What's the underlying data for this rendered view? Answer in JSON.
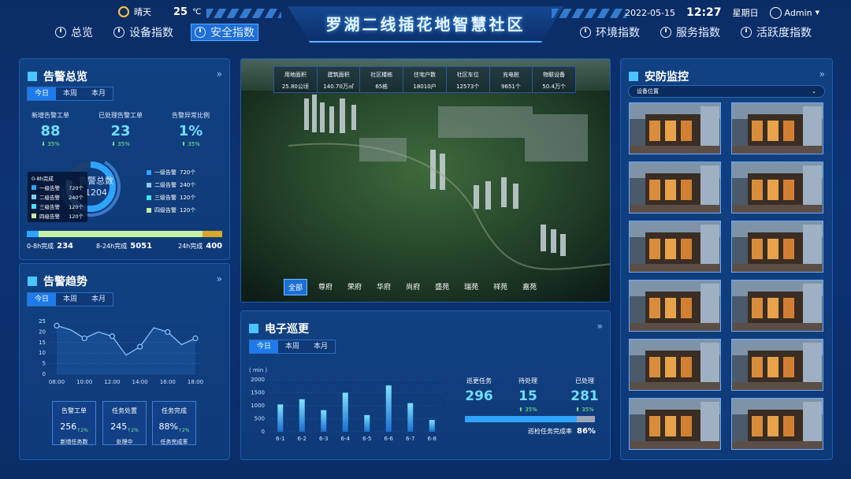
{
  "header": {
    "weather": "晴天",
    "temperature": "25",
    "unit": "℃",
    "date": "2022-05-15",
    "time": "12:27",
    "weekday": "星期日",
    "user": "Admin",
    "title": "罗湖二线插花地智慧社区",
    "nav_left": [
      "总览",
      "设备指数",
      "安全指数"
    ],
    "nav_right": [
      "环境指数",
      "服务指数",
      "活跃度指数"
    ],
    "active_nav": "安全指数"
  },
  "alarm_overview": {
    "title": "告警总览",
    "tabs": [
      "今日",
      "本周",
      "本月"
    ],
    "stats": [
      {
        "label": "新增告警工单",
        "value": "88",
        "change": "35%"
      },
      {
        "label": "已处理告警工单",
        "value": "23",
        "change": "35%"
      },
      {
        "label": "告警异常比例",
        "value": "1%",
        "change": "35%"
      }
    ],
    "donut_label": "告警总数",
    "donut_value": "1204",
    "legend": [
      {
        "name": "一级告警",
        "value": "720个",
        "color": "#2fa4ff"
      },
      {
        "name": "二级告警",
        "value": "240个",
        "color": "#7fd0ff"
      },
      {
        "name": "三级告警",
        "value": "120个",
        "color": "#41e3ff"
      },
      {
        "name": "四级告警",
        "value": "120个",
        "color": "#c3f0a2"
      }
    ],
    "tooltip": {
      "title": "0-8h完成",
      "items": [
        {
          "name": "一级告警",
          "value": "720个"
        },
        {
          "name": "二级告警",
          "value": "240个"
        },
        {
          "name": "三级告警",
          "value": "120个"
        },
        {
          "name": "四级告警",
          "value": "120个"
        }
      ]
    },
    "progress": [
      {
        "label": "0-8h完成",
        "value": "234",
        "color": "#2fa4ff"
      },
      {
        "label": "8-24h完成",
        "value": "5051",
        "color": "#c3f0a2"
      },
      {
        "label": "24h完成",
        "value": "400",
        "color": "#d9a82a"
      }
    ]
  },
  "alarm_trend": {
    "title": "告警趋势",
    "tabs": [
      "今日",
      "本周",
      "本月"
    ],
    "chart_data": {
      "type": "line",
      "x": [
        "08:00",
        "09:00",
        "10:00",
        "11:00",
        "12:00",
        "13:00",
        "14:00",
        "15:00",
        "16:00",
        "17:00",
        "18:00"
      ],
      "y": [
        23,
        21,
        17,
        20,
        18,
        9,
        13,
        22,
        20,
        14,
        17
      ],
      "yticks": [
        0,
        5,
        10,
        15,
        20,
        25
      ],
      "xticks": [
        "08:00",
        "10:00",
        "12:00",
        "14:00",
        "16:00",
        "18:00"
      ],
      "ylim": [
        0,
        25
      ]
    },
    "metrics": [
      {
        "title": "告警工单",
        "value": "256",
        "change": "2%",
        "sub": "新增任务数"
      },
      {
        "title": "任务处置",
        "value": "245",
        "change": "2%",
        "sub": "处理中"
      },
      {
        "title": "任务完成",
        "value": "88%",
        "change": "2%",
        "sub": "任务完成率"
      }
    ]
  },
  "community": {
    "info": [
      {
        "label": "用地面积",
        "value": "25.80公顷"
      },
      {
        "label": "建筑面积",
        "value": "140.70万㎡"
      },
      {
        "label": "社区楼栋",
        "value": "65栋"
      },
      {
        "label": "住宅户数",
        "value": "18010户"
      },
      {
        "label": "社区车位",
        "value": "12573个"
      },
      {
        "label": "充电桩",
        "value": "9651个"
      },
      {
        "label": "物联设备",
        "value": "50.4万个"
      }
    ],
    "districts": [
      "全部",
      "尊府",
      "荣府",
      "华府",
      "尚府",
      "盛苑",
      "瑞苑",
      "祥苑",
      "嘉苑"
    ],
    "active_district": "全部"
  },
  "patrol": {
    "title": "电子巡更",
    "tabs": [
      "今日",
      "本周",
      "本月"
    ],
    "chart_data": {
      "type": "bar",
      "unit": "( min )",
      "categories": [
        "6-1",
        "6-2",
        "6-3",
        "6-4",
        "6-5",
        "6-6",
        "6-7",
        "6-8"
      ],
      "values": [
        1050,
        1250,
        830,
        1500,
        640,
        1780,
        1100,
        450
      ],
      "yticks": [
        0,
        500,
        1000,
        1500,
        2000
      ],
      "ylim": [
        0,
        2000
      ]
    },
    "stats": [
      {
        "label": "巡更任务",
        "value": "296",
        "change": ""
      },
      {
        "label": "待处理",
        "value": "15",
        "change": "35%"
      },
      {
        "label": "已处理",
        "value": "281",
        "change": "35%"
      }
    ],
    "completion_label": "巡检任务完成率",
    "completion_value": "86%",
    "completion": 0.86
  },
  "security": {
    "title": "安防监控",
    "select_placeholder": "设备位置",
    "camera_count": 12
  }
}
